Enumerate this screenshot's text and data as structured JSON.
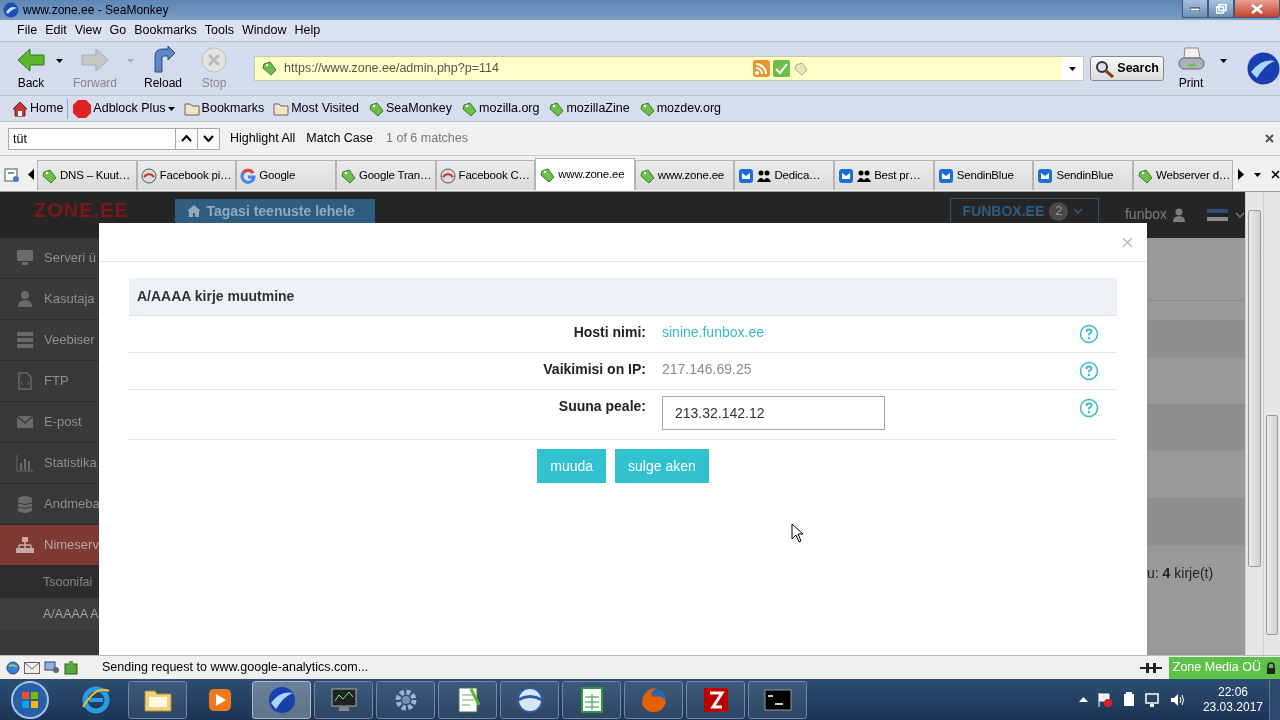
{
  "window": {
    "title": "www.zone.ee - SeaMonkey"
  },
  "menu": [
    "File",
    "Edit",
    "View",
    "Go",
    "Bookmarks",
    "Tools",
    "Window",
    "Help"
  ],
  "nav_buttons": [
    {
      "kind": "back",
      "label": "Back",
      "disabled": false,
      "has_menu": true
    },
    {
      "kind": "forward",
      "label": "Forward",
      "disabled": true,
      "has_menu": true
    },
    {
      "kind": "reload",
      "label": "Reload",
      "disabled": false,
      "has_menu": false
    },
    {
      "kind": "stop",
      "label": "Stop",
      "disabled": true,
      "has_menu": false
    }
  ],
  "address_bar": {
    "url": "https://www.zone.ee/admin.php?p=114"
  },
  "search_button": "Search",
  "print_button": "Print",
  "bookmarks": [
    {
      "kind": "home",
      "label": "Home"
    },
    {
      "kind": "addon",
      "label": "Adblock Plus"
    },
    {
      "kind": "folder",
      "label": "Bookmarks"
    },
    {
      "kind": "folder",
      "label": "Most Visited"
    },
    {
      "kind": "link",
      "label": "SeaMonkey"
    },
    {
      "kind": "link",
      "label": "mozilla.org"
    },
    {
      "kind": "link",
      "label": "mozillaZine"
    },
    {
      "kind": "link",
      "label": "mozdev.org"
    }
  ],
  "find_bar": {
    "value": "tüt",
    "options": [
      "Highlight All",
      "Match Case"
    ],
    "status": "1 of 6 matches"
  },
  "tabs": [
    {
      "label": "DNS – Kuut…",
      "kind": "tag",
      "selected": false
    },
    {
      "label": "Facebook pi…",
      "kind": "round",
      "selected": false
    },
    {
      "label": "Google",
      "kind": "ring",
      "selected": false
    },
    {
      "label": "Google Tran…",
      "kind": "tag",
      "selected": false
    },
    {
      "label": "Facebook C…",
      "kind": "round",
      "selected": false
    },
    {
      "label": "www.zone.ee",
      "kind": "tag",
      "selected": true
    },
    {
      "label": "www.zone.ee",
      "kind": "tag",
      "selected": false
    },
    {
      "label": "Dedica…",
      "kind": "mail-group",
      "selected": false
    },
    {
      "label": "Best pr…",
      "kind": "mail-group",
      "selected": false
    },
    {
      "label": "SendinBlue",
      "kind": "mail",
      "selected": false
    },
    {
      "label": "SendinBlue",
      "kind": "mail",
      "selected": false
    },
    {
      "label": "Webserver d…",
      "kind": "tag",
      "selected": false
    }
  ],
  "page": {
    "logo": "ZONE.EE",
    "back_button": "Tagasi teenuste lehele",
    "account": {
      "name": "FUNBOX.EE",
      "count": "2"
    },
    "user": "funbox",
    "sidebar": [
      {
        "label": "Serveri ü",
        "kind": "monitor",
        "selected": false
      },
      {
        "label": "Kasutaja",
        "kind": "user",
        "selected": false
      },
      {
        "label": "Veebiser",
        "kind": "server",
        "selected": false
      },
      {
        "label": "FTP",
        "kind": "file",
        "selected": false
      },
      {
        "label": "E-post",
        "kind": "mail",
        "selected": false
      },
      {
        "label": "Statistika",
        "kind": "chart",
        "selected": false
      },
      {
        "label": "Andmeba",
        "kind": "database",
        "selected": false
      },
      {
        "label": "Nimeserv",
        "kind": "sitemap",
        "selected": true
      }
    ],
    "subitems": [
      {
        "label": "Tsoonifai",
        "selected": false
      },
      {
        "label": "A/AAAA A",
        "selected": true
      }
    ],
    "summary": "u: **4** kirje(t)"
  },
  "modal": {
    "title": "A/AAAA kirje muutmine",
    "fields": [
      {
        "label": "Hosti nimi:",
        "kind": "link",
        "value": "sinine.funbox.ee"
      },
      {
        "label": "Vaikimisi on IP:",
        "kind": "static",
        "value": "217.146.69.25"
      },
      {
        "label": "Suuna peale:",
        "kind": "input",
        "value": "213.32.142.12"
      }
    ],
    "buttons": [
      "muuda",
      "sulge aken"
    ]
  },
  "status_bar": {
    "text": "Sending request to www.google-analytics.com...",
    "site": "Zone Media OÜ"
  },
  "taskbar": {
    "apps": [
      {
        "kind": "browser-e",
        "running": false,
        "selected": false
      },
      {
        "kind": "folder",
        "running": true,
        "selected": false
      },
      {
        "kind": "player",
        "running": false,
        "selected": false
      },
      {
        "kind": "bird",
        "running": true,
        "selected": true
      },
      {
        "kind": "monitor",
        "running": true,
        "selected": false
      },
      {
        "kind": "gear",
        "running": true,
        "selected": false
      },
      {
        "kind": "notepad",
        "running": true,
        "selected": false
      },
      {
        "kind": "globe",
        "running": true,
        "selected": false
      },
      {
        "kind": "sheet",
        "running": true,
        "selected": false
      },
      {
        "kind": "fox",
        "running": true,
        "selected": false
      },
      {
        "kind": "bolt",
        "running": true,
        "selected": false
      },
      {
        "kind": "terminal",
        "running": true,
        "selected": false
      }
    ],
    "time": "22:06",
    "date": "23.03.2017"
  }
}
